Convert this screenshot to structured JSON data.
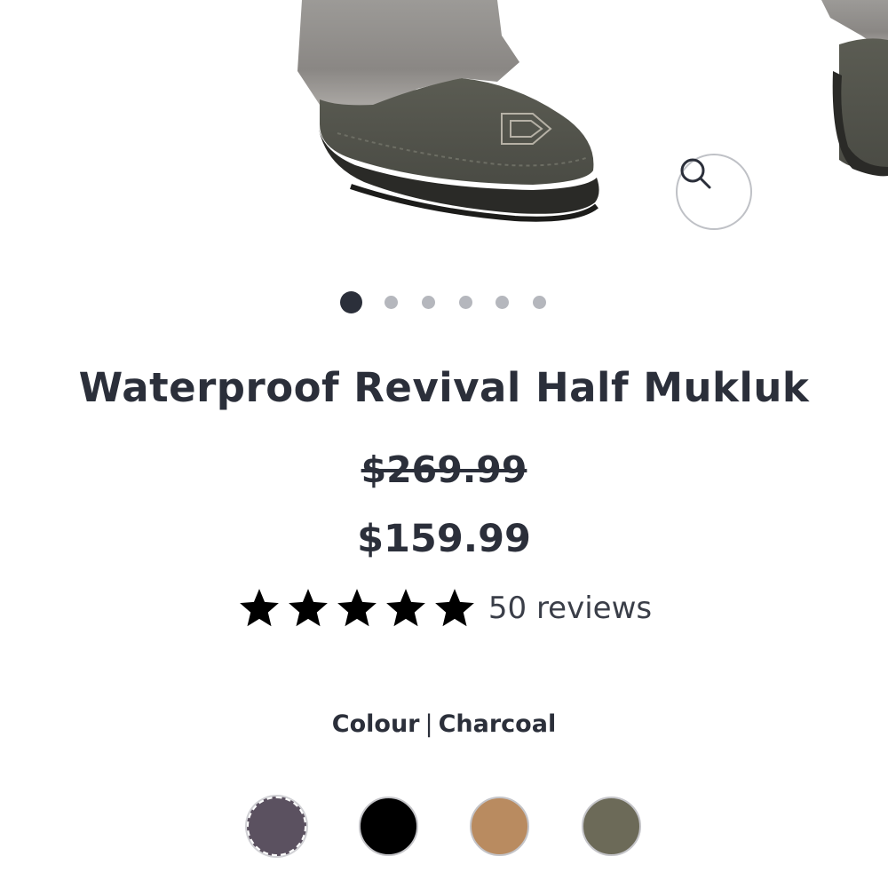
{
  "product": {
    "title": "Waterproof Revival Half Mukluk",
    "original_price": "$269.99",
    "sale_price": "$159.99",
    "rating": 5,
    "rating_max": 5,
    "reviews_label": "50 reviews"
  },
  "gallery": {
    "zoom_icon": "search-icon",
    "slide_count": 6,
    "active_slide": 1
  },
  "colour": {
    "label": "Colour",
    "separator": "|",
    "selected": "Charcoal",
    "swatches": [
      {
        "color": "#5b5160"
      },
      {
        "color": "#000000"
      },
      {
        "color": "#b98b60"
      },
      {
        "color": "#6c6a58"
      }
    ]
  },
  "theme": {
    "text": "#2b2f3a",
    "dot_active": "#2b2f3a",
    "dot_inactive": "#b5b7bd"
  }
}
